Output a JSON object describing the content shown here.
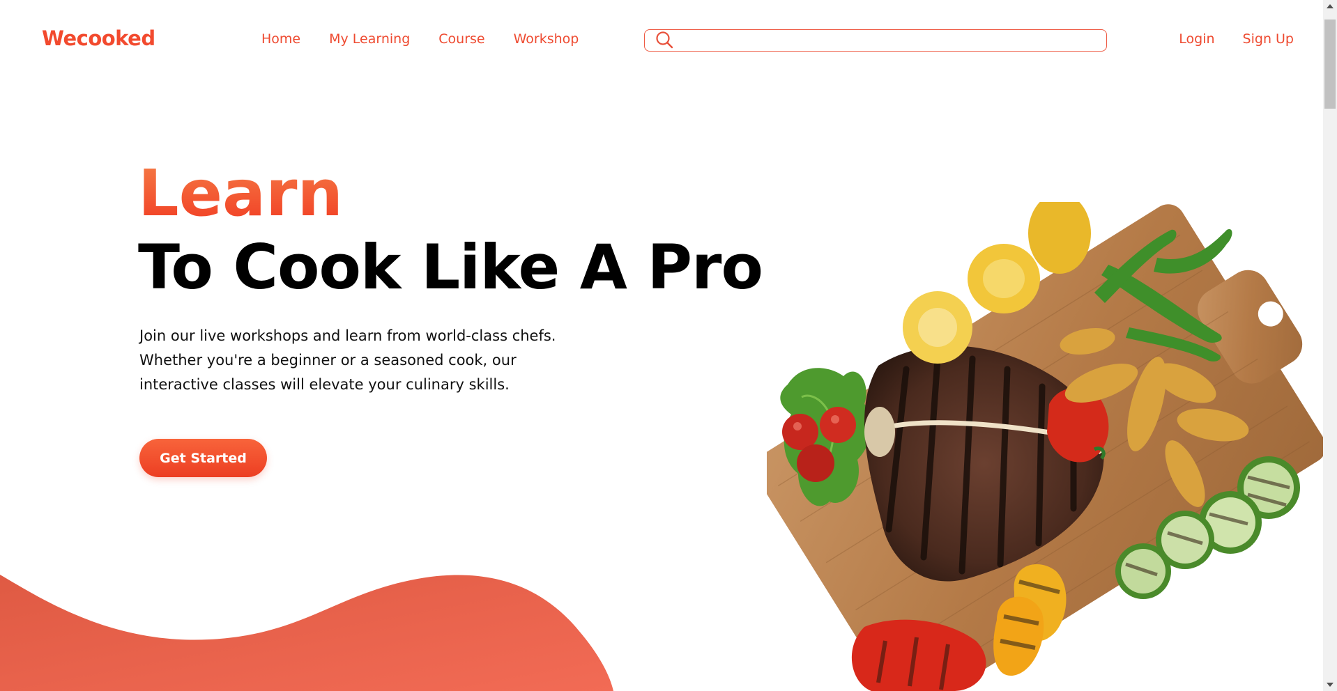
{
  "header": {
    "logo": "Wecooked",
    "nav": [
      {
        "label": "Home"
      },
      {
        "label": "My Learning"
      },
      {
        "label": "Course"
      },
      {
        "label": "Workshop"
      }
    ],
    "search": {
      "value": "",
      "placeholder": ""
    },
    "auth": {
      "login": "Login",
      "signup": "Sign Up"
    }
  },
  "hero": {
    "highlight": "Learn",
    "title": "To Cook Like A Pro",
    "description": "Join our live workshops and learn from world-class chefs. Whether you're a beginner or a seasoned cook, our interactive classes will elevate your culinary skills.",
    "cta": "Get Started"
  },
  "theme": {
    "accent": "#f24a2e",
    "wave": "#e8604a"
  },
  "icons": {
    "search": "search-icon"
  }
}
